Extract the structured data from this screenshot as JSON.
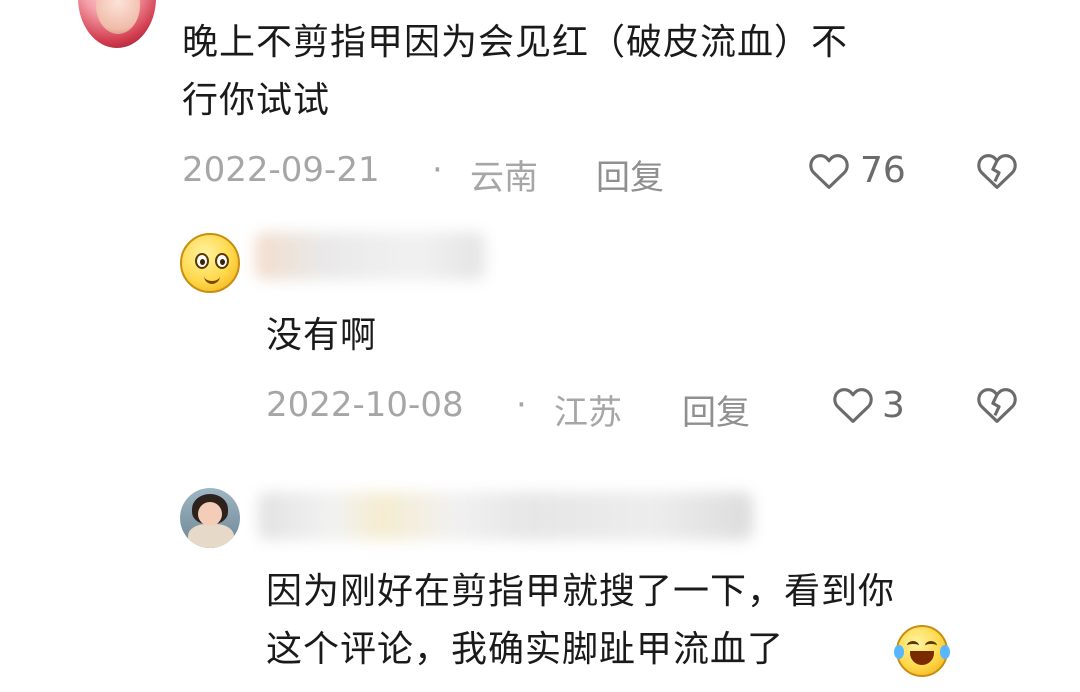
{
  "comment": {
    "line1": "晚上不剪指甲因为会见红（破皮流血）不",
    "line2": "行你试试",
    "date": "2022-09-21",
    "separator": "·",
    "location": "云南",
    "reply_label": "回复",
    "likes": "76"
  },
  "reply1": {
    "text": "没有啊",
    "date": "2022-10-08",
    "separator": "·",
    "location": "江苏",
    "reply_label": "回复",
    "likes": "3"
  },
  "reply2": {
    "line1": "因为刚好在剪指甲就搜了一下，看到你",
    "line2": "这个评论，我确实脚趾甲流血了"
  },
  "icons": {
    "heart": "heart-outline-icon",
    "dislike": "broken-heart-icon",
    "laugh": "tears-of-joy-emoji"
  },
  "colors": {
    "text": "#1a1a1a",
    "meta": "#a6a6a6",
    "icon": "#6b6b6b"
  }
}
